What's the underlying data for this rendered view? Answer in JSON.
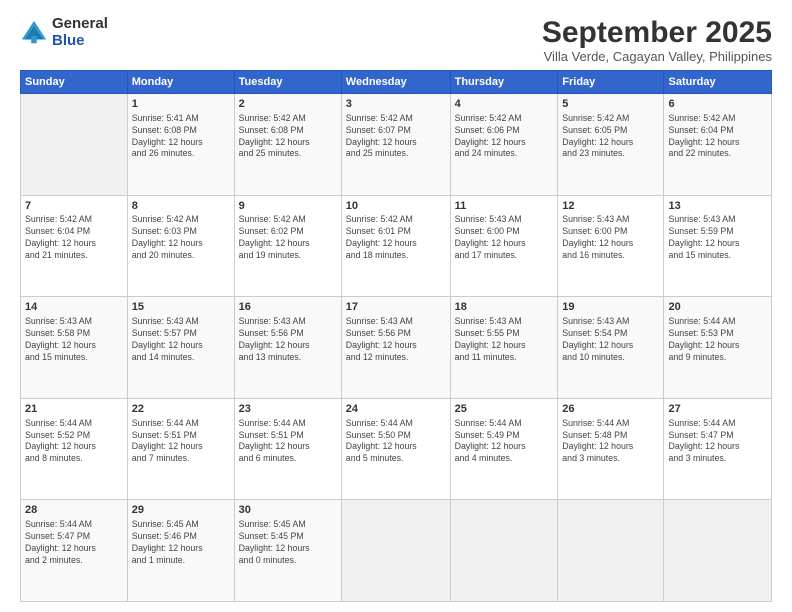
{
  "logo": {
    "general": "General",
    "blue": "Blue"
  },
  "title": "September 2025",
  "subtitle": "Villa Verde, Cagayan Valley, Philippines",
  "header_days": [
    "Sunday",
    "Monday",
    "Tuesday",
    "Wednesday",
    "Thursday",
    "Friday",
    "Saturday"
  ],
  "weeks": [
    [
      {
        "day": "",
        "info": ""
      },
      {
        "day": "1",
        "info": "Sunrise: 5:41 AM\nSunset: 6:08 PM\nDaylight: 12 hours\nand 26 minutes."
      },
      {
        "day": "2",
        "info": "Sunrise: 5:42 AM\nSunset: 6:08 PM\nDaylight: 12 hours\nand 25 minutes."
      },
      {
        "day": "3",
        "info": "Sunrise: 5:42 AM\nSunset: 6:07 PM\nDaylight: 12 hours\nand 25 minutes."
      },
      {
        "day": "4",
        "info": "Sunrise: 5:42 AM\nSunset: 6:06 PM\nDaylight: 12 hours\nand 24 minutes."
      },
      {
        "day": "5",
        "info": "Sunrise: 5:42 AM\nSunset: 6:05 PM\nDaylight: 12 hours\nand 23 minutes."
      },
      {
        "day": "6",
        "info": "Sunrise: 5:42 AM\nSunset: 6:04 PM\nDaylight: 12 hours\nand 22 minutes."
      }
    ],
    [
      {
        "day": "7",
        "info": "Sunrise: 5:42 AM\nSunset: 6:04 PM\nDaylight: 12 hours\nand 21 minutes."
      },
      {
        "day": "8",
        "info": "Sunrise: 5:42 AM\nSunset: 6:03 PM\nDaylight: 12 hours\nand 20 minutes."
      },
      {
        "day": "9",
        "info": "Sunrise: 5:42 AM\nSunset: 6:02 PM\nDaylight: 12 hours\nand 19 minutes."
      },
      {
        "day": "10",
        "info": "Sunrise: 5:42 AM\nSunset: 6:01 PM\nDaylight: 12 hours\nand 18 minutes."
      },
      {
        "day": "11",
        "info": "Sunrise: 5:43 AM\nSunset: 6:00 PM\nDaylight: 12 hours\nand 17 minutes."
      },
      {
        "day": "12",
        "info": "Sunrise: 5:43 AM\nSunset: 6:00 PM\nDaylight: 12 hours\nand 16 minutes."
      },
      {
        "day": "13",
        "info": "Sunrise: 5:43 AM\nSunset: 5:59 PM\nDaylight: 12 hours\nand 15 minutes."
      }
    ],
    [
      {
        "day": "14",
        "info": "Sunrise: 5:43 AM\nSunset: 5:58 PM\nDaylight: 12 hours\nand 15 minutes."
      },
      {
        "day": "15",
        "info": "Sunrise: 5:43 AM\nSunset: 5:57 PM\nDaylight: 12 hours\nand 14 minutes."
      },
      {
        "day": "16",
        "info": "Sunrise: 5:43 AM\nSunset: 5:56 PM\nDaylight: 12 hours\nand 13 minutes."
      },
      {
        "day": "17",
        "info": "Sunrise: 5:43 AM\nSunset: 5:56 PM\nDaylight: 12 hours\nand 12 minutes."
      },
      {
        "day": "18",
        "info": "Sunrise: 5:43 AM\nSunset: 5:55 PM\nDaylight: 12 hours\nand 11 minutes."
      },
      {
        "day": "19",
        "info": "Sunrise: 5:43 AM\nSunset: 5:54 PM\nDaylight: 12 hours\nand 10 minutes."
      },
      {
        "day": "20",
        "info": "Sunrise: 5:44 AM\nSunset: 5:53 PM\nDaylight: 12 hours\nand 9 minutes."
      }
    ],
    [
      {
        "day": "21",
        "info": "Sunrise: 5:44 AM\nSunset: 5:52 PM\nDaylight: 12 hours\nand 8 minutes."
      },
      {
        "day": "22",
        "info": "Sunrise: 5:44 AM\nSunset: 5:51 PM\nDaylight: 12 hours\nand 7 minutes."
      },
      {
        "day": "23",
        "info": "Sunrise: 5:44 AM\nSunset: 5:51 PM\nDaylight: 12 hours\nand 6 minutes."
      },
      {
        "day": "24",
        "info": "Sunrise: 5:44 AM\nSunset: 5:50 PM\nDaylight: 12 hours\nand 5 minutes."
      },
      {
        "day": "25",
        "info": "Sunrise: 5:44 AM\nSunset: 5:49 PM\nDaylight: 12 hours\nand 4 minutes."
      },
      {
        "day": "26",
        "info": "Sunrise: 5:44 AM\nSunset: 5:48 PM\nDaylight: 12 hours\nand 3 minutes."
      },
      {
        "day": "27",
        "info": "Sunrise: 5:44 AM\nSunset: 5:47 PM\nDaylight: 12 hours\nand 3 minutes."
      }
    ],
    [
      {
        "day": "28",
        "info": "Sunrise: 5:44 AM\nSunset: 5:47 PM\nDaylight: 12 hours\nand 2 minutes."
      },
      {
        "day": "29",
        "info": "Sunrise: 5:45 AM\nSunset: 5:46 PM\nDaylight: 12 hours\nand 1 minute."
      },
      {
        "day": "30",
        "info": "Sunrise: 5:45 AM\nSunset: 5:45 PM\nDaylight: 12 hours\nand 0 minutes."
      },
      {
        "day": "",
        "info": ""
      },
      {
        "day": "",
        "info": ""
      },
      {
        "day": "",
        "info": ""
      },
      {
        "day": "",
        "info": ""
      }
    ]
  ]
}
